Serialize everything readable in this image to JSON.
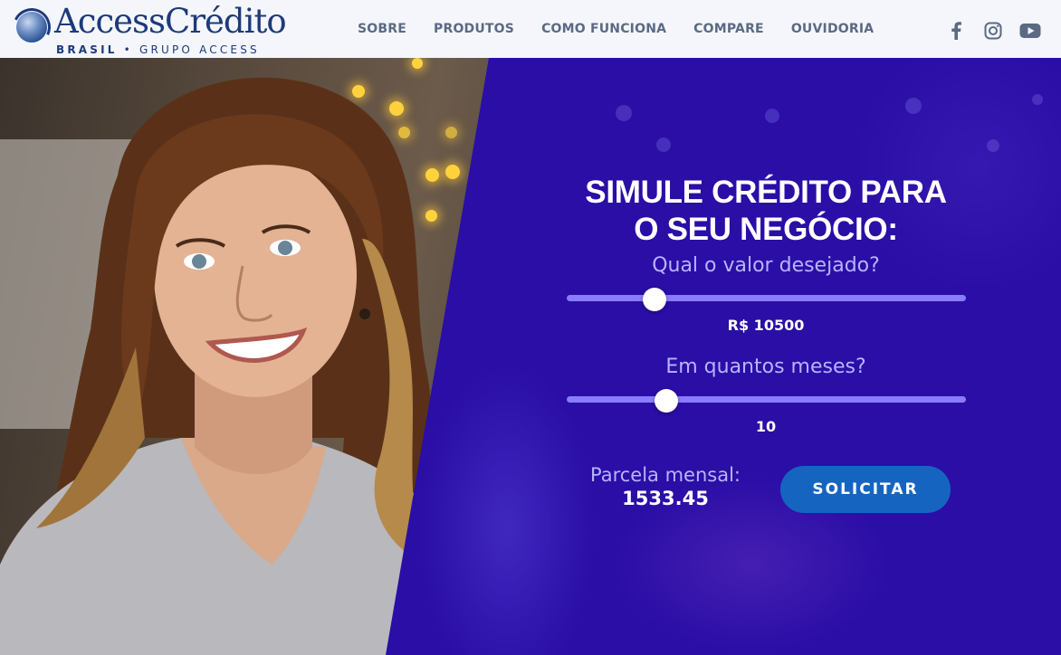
{
  "brand": {
    "name": "AccessCrédito",
    "tagline_a": "BRASIL",
    "tagline_sep": "•",
    "tagline_b": "GRUPO ACCESS"
  },
  "nav": {
    "items": [
      {
        "label": "SOBRE"
      },
      {
        "label": "PRODUTOS"
      },
      {
        "label": "COMO FUNCIONA"
      },
      {
        "label": "COMPARE"
      },
      {
        "label": "OUVIDORIA"
      }
    ]
  },
  "socials": [
    "facebook-icon",
    "instagram-icon",
    "youtube-icon"
  ],
  "simulator": {
    "title_line1": "SIMULE CRÉDITO PARA",
    "title_line2": "O SEU NEGÓCIO:",
    "amount_question": "Qual o valor desejado?",
    "amount_value": "R$ 10500",
    "amount_slider_fraction": 0.22,
    "months_question": "Em quantos meses?",
    "months_value": "10",
    "months_slider_fraction": 0.25,
    "installment_label": "Parcela mensal:",
    "installment_value": "1533.45",
    "submit_label": "SOLICITAR"
  },
  "colors": {
    "panel": "#2a0ea6",
    "accent_track": "#8a7cff",
    "button": "#1565c0",
    "nav_text": "#5b6a83",
    "brand_blue": "#1d3a7a"
  }
}
